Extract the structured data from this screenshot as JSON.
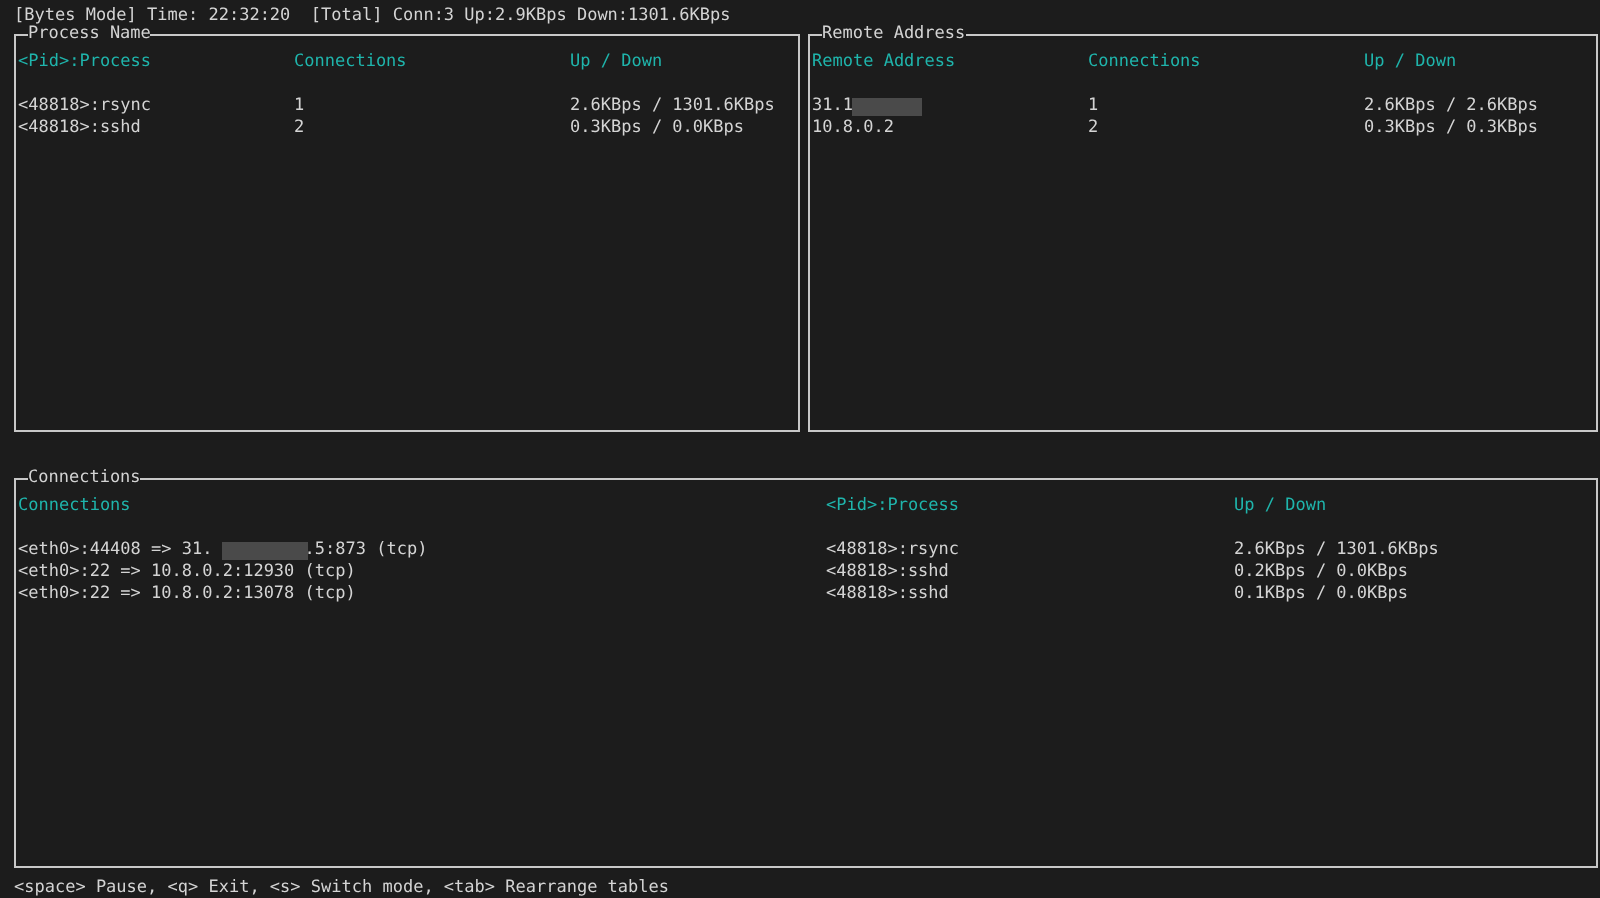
{
  "status_line": "[Bytes Mode] Time: 22:32:20  [Total] Conn:3 Up:2.9KBps Down:1301.6KBps",
  "panels": [
    {
      "title": "Process Name",
      "columns": [
        "<Pid>:Process",
        "Connections",
        "Up / Down"
      ],
      "rows": [
        {
          "cells": [
            "<48818>:rsync",
            "1",
            "2.6KBps / 1301.6KBps"
          ],
          "redacted": false
        },
        {
          "cells": [
            "<48818>:sshd",
            "2",
            "0.3KBps / 0.0KBps"
          ],
          "redacted": false
        }
      ]
    },
    {
      "title": "Remote Address",
      "columns": [
        "Remote Address",
        "Connections",
        "Up / Down"
      ],
      "rows": [
        {
          "cells": [
            "31.1",
            "1",
            "2.6KBps / 2.6KBps"
          ],
          "redacted": true
        },
        {
          "cells": [
            "10.8.0.2",
            "2",
            "0.3KBps / 0.3KBps"
          ],
          "redacted": false
        }
      ]
    },
    {
      "title": "Connections",
      "columns": [
        "Connections",
        "<Pid>:Process",
        "Up / Down"
      ],
      "rows": [
        {
          "cells": [
            "<eth0>:44408 => 31.         .5:873 (tcp)",
            "<48818>:rsync",
            "2.6KBps / 1301.6KBps"
          ],
          "redacted": true
        },
        {
          "cells": [
            "<eth0>:22 => 10.8.0.2:12930 (tcp)",
            "<48818>:sshd",
            "0.2KBps / 0.0KBps"
          ],
          "redacted": false
        },
        {
          "cells": [
            "<eth0>:22 => 10.8.0.2:13078 (tcp)",
            "<48818>:sshd",
            "0.1KBps / 0.0KBps"
          ],
          "redacted": false
        }
      ]
    }
  ],
  "footer": "<space> Pause, <q> Exit, <s> Switch mode, <tab> Rearrange tables"
}
